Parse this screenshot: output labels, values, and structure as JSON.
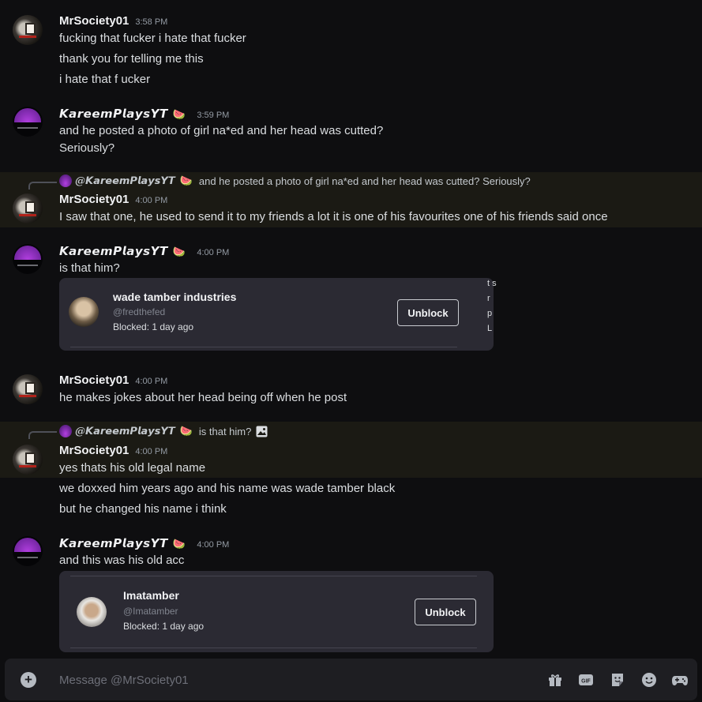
{
  "users": {
    "mr": "MrSociety01",
    "ka": "𝙆𝙖𝙧𝙚𝙚𝙢𝙋𝙡𝙖𝙮𝙨𝙔𝙏",
    "ka_emoji": "🍉",
    "ka_reply": "@𝙆𝙖𝙧𝙚𝙚𝙢𝙋𝙡𝙖𝙮𝙨𝙔𝙏"
  },
  "messages": [
    {
      "time": "3:58 PM",
      "lines": [
        "fucking that fucker i hate that fucker",
        "thank you for telling me this",
        "i hate that f ucker"
      ]
    },
    {
      "time": "3:59 PM",
      "lines": [
        "and he posted a photo of girl na*ed and her head was cutted?",
        "Seriously?"
      ]
    },
    {
      "time": "4:00 PM",
      "reply": "and he posted a photo of girl na*ed and her head was cutted? Seriously?",
      "lines": [
        "I saw that one, he used to send it to my friends a lot it is one of his favourites one of his friends said once"
      ]
    },
    {
      "time": "4:00 PM",
      "lines": [
        "is that him?"
      ],
      "card": {
        "name": "wade tamber industries",
        "handle": "@fredthefed",
        "status": "Blocked: 1 day ago",
        "button": "Unblock",
        "partial_text": "t s r p L"
      }
    },
    {
      "time": "4:00 PM",
      "lines": [
        "he makes jokes about her head being off when he post"
      ]
    },
    {
      "time": "4:00 PM",
      "reply": "is that him?",
      "lines": [
        "yes thats his old legal name",
        "we doxxed him years ago and his name was wade tamber black",
        "but he changed his name i think"
      ]
    },
    {
      "time": "4:00 PM",
      "lines": [
        "and this was his old acc"
      ],
      "card": {
        "name": "Imatamber",
        "handle": "@Imatamber",
        "status": "Blocked: 1 day ago",
        "button": "Unblock"
      }
    }
  ],
  "composer": {
    "placeholder": "Message @MrSociety01",
    "plus": "+"
  },
  "icons": [
    "plus-circle-icon",
    "gift-icon",
    "gif-icon",
    "sticker-icon",
    "emoji-icon",
    "gamepad-icon"
  ],
  "colors": {
    "background": "#0e0e10",
    "highlight": "#1b1a14",
    "card": "#2b2a33",
    "composer": "#1e1e22"
  }
}
